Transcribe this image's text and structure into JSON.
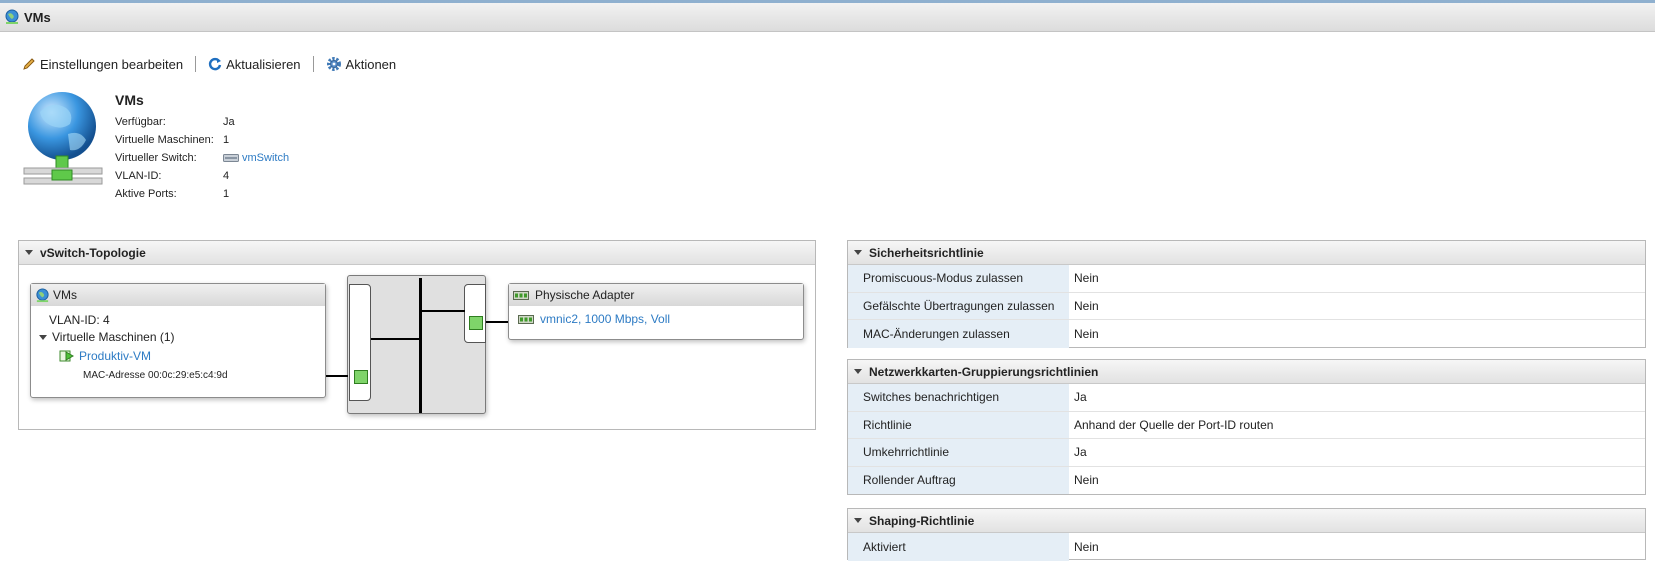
{
  "window": {
    "title": "VMs"
  },
  "toolbar": {
    "edit_label": "Einstellungen bearbeiten",
    "refresh_label": "Aktualisieren",
    "actions_label": "Aktionen"
  },
  "summary": {
    "name": "VMs",
    "rows": [
      {
        "key": "Verfügbar:",
        "value": "Ja"
      },
      {
        "key": "Virtuelle Maschinen:",
        "value": "1"
      },
      {
        "key": "Virtueller Switch:",
        "value": "vmSwitch"
      },
      {
        "key": "VLAN-ID:",
        "value": "4"
      },
      {
        "key": "Aktive Ports:",
        "value": "1"
      }
    ]
  },
  "topology": {
    "title": "vSwitch-Topologie",
    "portgroup": {
      "name": "VMs",
      "vlan": "VLAN-ID: 4",
      "vms_header": "Virtuelle Maschinen (1)",
      "vm_name": "Produktiv-VM",
      "mac": "MAC-Adresse 00:0c:29:e5:c4:9d"
    },
    "adapters": {
      "title": "Physische Adapter",
      "nic": "vmnic2, 1000 Mbps, Voll"
    }
  },
  "security": {
    "title": "Sicherheitsrichtlinie",
    "rows": [
      {
        "key": "Promiscuous-Modus zulassen",
        "value": "Nein"
      },
      {
        "key": "Gefälschte Übertragungen zulassen",
        "value": "Nein"
      },
      {
        "key": "MAC-Änderungen zulassen",
        "value": "Nein"
      }
    ]
  },
  "teaming": {
    "title": "Netzwerkkarten-Gruppierungsrichtlinien",
    "rows": [
      {
        "key": "Switches benachrichtigen",
        "value": "Ja"
      },
      {
        "key": "Richtlinie",
        "value": "Anhand der Quelle der Port-ID routen"
      },
      {
        "key": "Umkehrrichtlinie",
        "value": "Ja"
      },
      {
        "key": "Rollender Auftrag",
        "value": "Nein"
      }
    ]
  },
  "shaping": {
    "title": "Shaping-Richtlinie",
    "rows": [
      {
        "key": "Aktiviert",
        "value": "Nein"
      }
    ]
  },
  "icons": {
    "title": "network-globe-icon",
    "edit": "pencil-icon",
    "refresh": "refresh-icon",
    "actions": "gear-icon",
    "switch": "switch-icon",
    "nic": "nic-icon",
    "vm": "vm-icon",
    "port": "port-icon"
  },
  "colors": {
    "link": "#2d7bc4",
    "key_bg": "#e5eef6",
    "port": "#7fd46a"
  }
}
